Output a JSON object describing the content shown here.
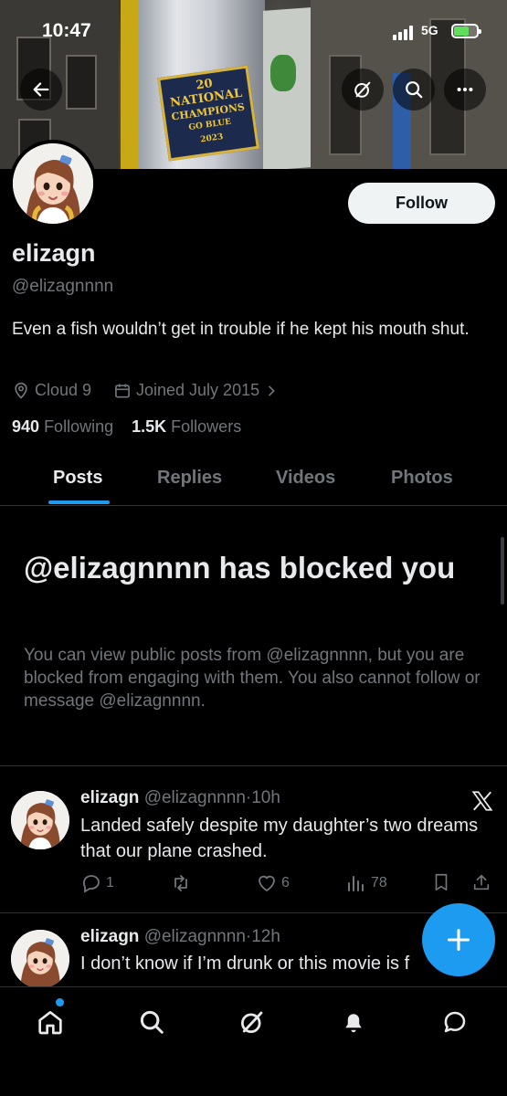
{
  "status_bar": {
    "time": "10:47",
    "network": "5G",
    "battery_percent": 60
  },
  "header": {
    "banner_sticker_lines": [
      "20",
      "NATIONAL",
      "CHAMPIONS",
      "GO BLUE",
      "2023"
    ],
    "back_icon": "arrow-left-icon",
    "grok_icon": "grok-icon",
    "search_icon": "search-icon",
    "more_icon": "more-horizontal-icon"
  },
  "profile": {
    "display_name": "elizagn",
    "handle": "@elizagnnnn",
    "follow_label": "Follow",
    "bio": "Even a fish wouldn’t get in trouble if he kept his mouth shut.",
    "location": "Cloud 9",
    "joined": "Joined July 2015",
    "following_count": "940",
    "following_label": "Following",
    "followers_count": "1.5K",
    "followers_label": "Followers"
  },
  "tabs": [
    {
      "label": "Posts",
      "active": true
    },
    {
      "label": "Replies",
      "active": false
    },
    {
      "label": "Videos",
      "active": false
    },
    {
      "label": "Photos",
      "active": false
    }
  ],
  "blocked": {
    "title": "@elizagnnnn has blocked you",
    "description": "You can view public posts from @elizagnnnn, but you are blocked from engaging with them. You also cannot follow or message @elizagnnnn."
  },
  "posts": [
    {
      "name": "elizagn",
      "handle": "@elizagnnnn",
      "time": "10h",
      "text": "Landed safely despite my daughter’s two dreams that our plane crashed.",
      "replies": "1",
      "retweets": "",
      "likes": "6",
      "views": "78"
    },
    {
      "name": "elizagn",
      "handle": "@elizagnnnn",
      "time": "12h",
      "text": "I don’t know if I’m drunk or this movie is f"
    }
  ],
  "bottom_nav": [
    "home-icon",
    "search-icon",
    "grok-icon",
    "notifications-icon",
    "messages-icon"
  ],
  "colors": {
    "accent": "#1d9bf0",
    "background": "#000000",
    "muted": "#71767b",
    "text": "#e7e9ea"
  }
}
